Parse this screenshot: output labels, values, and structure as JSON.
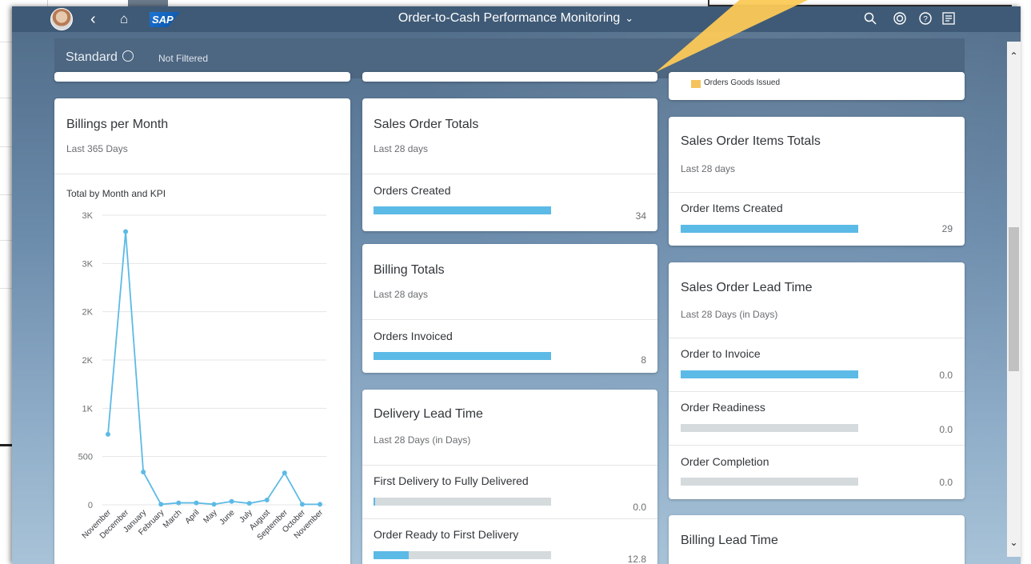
{
  "shell": {
    "title": "Order-to-Cash Performance Monitoring",
    "logo": "SAP",
    "icons": [
      "back-icon",
      "home-icon",
      "search-icon",
      "copilot-icon",
      "help-icon",
      "notifications-icon"
    ]
  },
  "filterbar": {
    "variant": "Standard",
    "filter_status": "Not Filtered"
  },
  "cards": {
    "billings": {
      "title": "Billings per Month",
      "subtitle": "Last 365 Days",
      "chart_label": "Total by Month and KPI"
    },
    "sales_order_totals": {
      "title": "Sales Order Totals",
      "subtitle": "Last 28 days",
      "kpis": [
        {
          "label": "Orders Created",
          "value": "34",
          "fill": 1.0
        }
      ]
    },
    "billing_totals": {
      "title": "Billing Totals",
      "subtitle": "Last 28 days",
      "kpis": [
        {
          "label": "Orders Invoiced",
          "value": "8",
          "fill": 1.0
        }
      ]
    },
    "delivery_lead_time": {
      "title": "Delivery Lead Time",
      "subtitle": "Last 28 Days (in Days)",
      "kpis": [
        {
          "label": "First Delivery to Fully Delivered",
          "value": "0.0",
          "fill": 0.01
        },
        {
          "label": "Order Ready to First Delivery",
          "value": "12.8",
          "fill": 0.2
        }
      ]
    },
    "top_right_partial": {
      "legend": "Orders Goods Issued"
    },
    "sales_order_items_totals": {
      "title": "Sales Order Items Totals",
      "subtitle": "Last 28 days",
      "kpis": [
        {
          "label": "Order Items Created",
          "value": "29",
          "fill": 1.0
        }
      ]
    },
    "sales_order_lead_time": {
      "title": "Sales Order Lead Time",
      "subtitle": "Last 28 Days (in Days)",
      "kpis": [
        {
          "label": "Order to Invoice",
          "value": "0.0",
          "fill": 1.0
        },
        {
          "label": "Order Readiness",
          "value": "0.0",
          "fill": 0.0
        },
        {
          "label": "Order Completion",
          "value": "0.0",
          "fill": 0.0
        }
      ]
    },
    "billing_lead_time": {
      "title": "Billing Lead Time"
    }
  },
  "colors": {
    "bar": "#5cbae6",
    "track": "#d5dadd",
    "line": "#5cbae6",
    "legend_swatch": "#f5c35c"
  },
  "chart_data": {
    "type": "line",
    "title": "Total by Month and KPI",
    "x": [
      "November",
      "December",
      "January",
      "February",
      "March",
      "April",
      "May",
      "June",
      "July",
      "August",
      "September",
      "October",
      "November"
    ],
    "series": [
      {
        "values": [
          730,
          2830,
          340,
          5,
          20,
          20,
          5,
          35,
          15,
          50,
          330,
          5,
          5
        ]
      }
    ],
    "yticks": [
      "0",
      "500",
      "1K",
      "2K",
      "2K",
      "3K",
      "3K"
    ],
    "ylim": [
      0,
      3000
    ],
    "grid": true
  }
}
